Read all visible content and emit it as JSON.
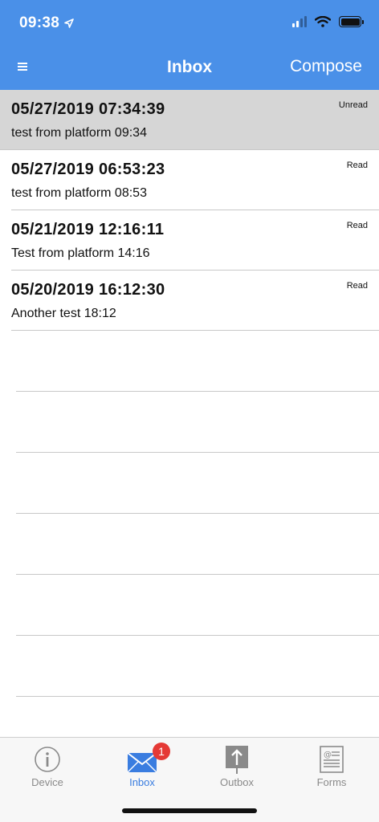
{
  "status_bar": {
    "time": "09:38"
  },
  "nav": {
    "title": "Inbox",
    "compose_label": "Compose"
  },
  "messages": [
    {
      "date": "05/27/2019 07:34:39",
      "subject": "test from platform 09:34",
      "status": "Unread"
    },
    {
      "date": "05/27/2019 06:53:23",
      "subject": "test from platform 08:53",
      "status": "Read"
    },
    {
      "date": "05/21/2019 12:16:11",
      "subject": "Test from platform 14:16",
      "status": "Read"
    },
    {
      "date": "05/20/2019 16:12:30",
      "subject": "Another test 18:12",
      "status": "Read"
    }
  ],
  "tabs": [
    {
      "label": "Device",
      "icon": "info-icon"
    },
    {
      "label": "Inbox",
      "icon": "envelope-icon",
      "badge": "1"
    },
    {
      "label": "Outbox",
      "icon": "upload-icon"
    },
    {
      "label": "Forms",
      "icon": "form-icon"
    }
  ],
  "colors": {
    "header": "#4a90e8",
    "active_tab": "#3a7de0",
    "badge": "#e53935",
    "unread_row": "#d6d6d6"
  }
}
